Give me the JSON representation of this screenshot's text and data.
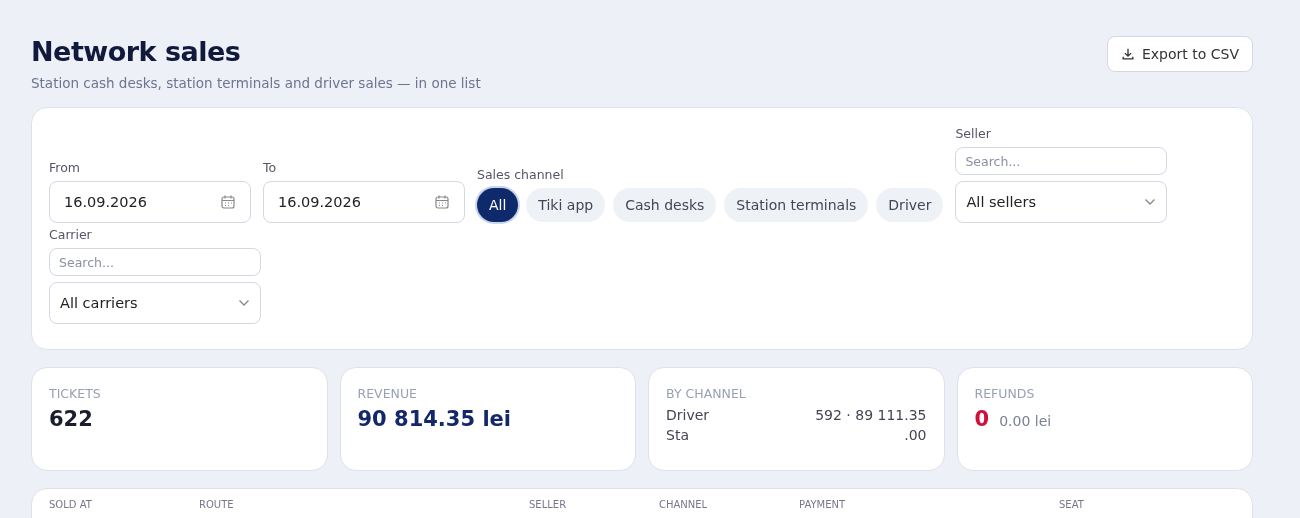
{
  "header": {
    "title": "Network sales",
    "subtitle": "Station cash desks, station terminals and driver sales — in one list",
    "export_button": "Export to CSV"
  },
  "filters": {
    "from": {
      "label": "From",
      "value": "16.09.2026"
    },
    "to": {
      "label": "To",
      "value": "16.09.2026"
    },
    "sales_channel": {
      "label": "Sales channel",
      "options": [
        {
          "label": "All",
          "selected": true
        },
        {
          "label": "Tiki app",
          "selected": false
        },
        {
          "label": "Cash desks",
          "selected": false
        },
        {
          "label": "Station terminals",
          "selected": false
        },
        {
          "label": "Driver",
          "selected": false
        }
      ]
    },
    "seller": {
      "label": "Seller",
      "placeholder": "Search...",
      "value": "All sellers"
    },
    "carrier": {
      "label": "Carrier",
      "placeholder": "Search...",
      "value": "All carriers"
    }
  },
  "stats": [
    {
      "kind": "plain",
      "label": "TICKETS",
      "value": "622"
    },
    {
      "kind": "money",
      "label": "REVENUE",
      "value": "90 814.35 lei"
    },
    {
      "kind": "channels",
      "label": "BY CHANNEL",
      "rows": [
        {
          "name": "Driver",
          "value": "592 · 89 111.35"
        },
        {
          "name": "Sta",
          "value": ".00"
        }
      ]
    },
    {
      "kind": "refunds",
      "label": "REFUNDS",
      "count": "0",
      "amount": "0.00 lei"
    }
  ],
  "table": {
    "columns": [
      "SOLD AT",
      "ROUTE",
      "SELLER",
      "CHANNEL",
      "PAYMENT",
      "SEAT"
    ]
  }
}
